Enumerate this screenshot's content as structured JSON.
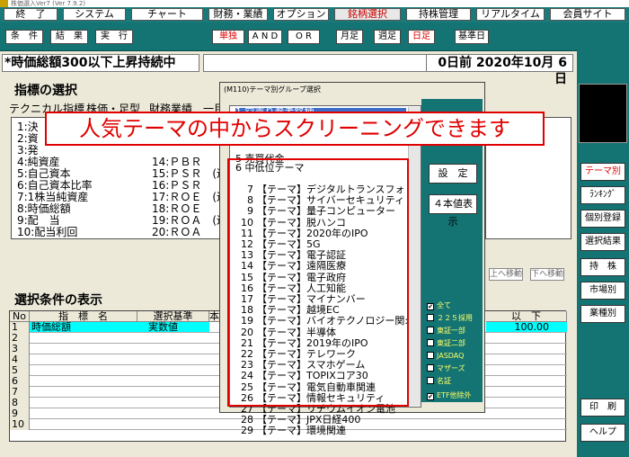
{
  "app": {
    "title": "株価選入Ver7 (Ver 7.9.2)"
  },
  "menu": [
    "終　了",
    "システム",
    "チャート",
    "財務・業績",
    "オプション",
    "銘柄選択",
    "持株管理",
    "リアルタイム",
    "会員サイト"
  ],
  "toolbar": {
    "buttons": [
      "条　件",
      "結　果",
      "実　行",
      "単独",
      "A N D",
      "O R",
      "月足",
      "週足",
      "日足",
      "基準日"
    ]
  },
  "status": {
    "left": "*時価総額300以下上昇持続中",
    "right": "0日前 2020年10月 6日"
  },
  "indicator_section": {
    "title": "指標の選択",
    "tabs": [
      "テクニカル指標",
      "株価・足型",
      "財務業績",
      "一目"
    ],
    "left_items": [
      "1:決",
      "2:資",
      "3:発",
      "4:純資産",
      "5:自己資本",
      "6:自己資本比率",
      "7:1株当純資産",
      "8:時価総額",
      "9:配　当",
      "10:配当利回"
    ],
    "mid_items": [
      "14:ＰＢＲ",
      "15:ＰＳＲ　(連",
      "16:ＰＳＲ",
      "17:ＲＯＥ　(連",
      "18:ＲＯＥ",
      "19:ＲＯＡ　(連",
      "20:ＲＯＡ"
    ]
  },
  "conditions": {
    "title": "選択条件の表示",
    "headers": [
      "No",
      "指　標　名",
      "選択基準",
      "本",
      "以　下"
    ],
    "rows": [
      {
        "no": "1",
        "name": "時価総額",
        "basis": "実数値",
        "max": "100.00"
      },
      {
        "no": "2"
      },
      {
        "no": "3"
      },
      {
        "no": "4"
      },
      {
        "no": "5"
      },
      {
        "no": "6"
      },
      {
        "no": "7"
      },
      {
        "no": "8"
      },
      {
        "no": "9"
      },
      {
        "no": "10"
      }
    ],
    "move_up": "上へ移動",
    "move_down": "下へ移動"
  },
  "dialog": {
    "title": "(M110)テーマ別グループ選択",
    "top_items": [
      "1 空売り参考銘柄",
      "5 売買代金",
      "6 中低位テーマ"
    ],
    "items": [
      {
        "no": "7",
        "name": "【テーマ】デジタルトランスフォ"
      },
      {
        "no": "8",
        "name": "【テーマ】サイバーセキュリティ"
      },
      {
        "no": "9",
        "name": "【テーマ】量子コンピューター"
      },
      {
        "no": "10",
        "name": "【テーマ】脱ハンコ"
      },
      {
        "no": "11",
        "name": "【テーマ】2020年のIPO"
      },
      {
        "no": "12",
        "name": "【テーマ】5G"
      },
      {
        "no": "13",
        "name": "【テーマ】電子認証"
      },
      {
        "no": "14",
        "name": "【テーマ】遠隔医療"
      },
      {
        "no": "15",
        "name": "【テーマ】電子政府"
      },
      {
        "no": "16",
        "name": "【テーマ】人工知能"
      },
      {
        "no": "17",
        "name": "【テーマ】マイナンバー"
      },
      {
        "no": "18",
        "name": "【テーマ】越境EC"
      },
      {
        "no": "19",
        "name": "【テーマ】バイオテクノロジー関:"
      },
      {
        "no": "20",
        "name": "【テーマ】半導体"
      },
      {
        "no": "21",
        "name": "【テーマ】2019年のIPO"
      },
      {
        "no": "22",
        "name": "【テーマ】テレワーク"
      },
      {
        "no": "23",
        "name": "【テーマ】スマホゲーム"
      },
      {
        "no": "24",
        "name": "【テーマ】TOPIXコア30"
      },
      {
        "no": "25",
        "name": "【テーマ】電気自動車関連"
      },
      {
        "no": "26",
        "name": "【テーマ】情報セキュリティ"
      },
      {
        "no": "27",
        "name": "【テーマ】リチウムイオン電池"
      },
      {
        "no": "28",
        "name": "【テーマ】JPX日経400"
      },
      {
        "no": "29",
        "name": "【テーマ】環境関連"
      }
    ],
    "set_button": "設　定",
    "four_button": "４本値表示",
    "checkboxes": [
      {
        "label": "全て",
        "checked": true
      },
      {
        "label": "２２５採用",
        "checked": false
      },
      {
        "label": "東証一部",
        "checked": false
      },
      {
        "label": "東証二部",
        "checked": false
      },
      {
        "label": "JASDAQ",
        "checked": false
      },
      {
        "label": "マザーズ",
        "checked": false
      },
      {
        "label": "名証",
        "checked": false
      },
      {
        "label": "ETF他除外",
        "checked": true
      }
    ]
  },
  "overlay": {
    "text": "人気テーマの中からスクリーニングできます"
  },
  "sidebar": {
    "buttons": [
      "テーマ別",
      "ﾗﾝｷﾝｸﾞ",
      "個別登録",
      "選択結果",
      "持　株",
      "市場別",
      "業種別",
      "印　刷",
      "ヘルプ"
    ]
  },
  "colors": {
    "teal": "#147474",
    "accent_red": "#e00000",
    "highlight": "#00ffff"
  }
}
